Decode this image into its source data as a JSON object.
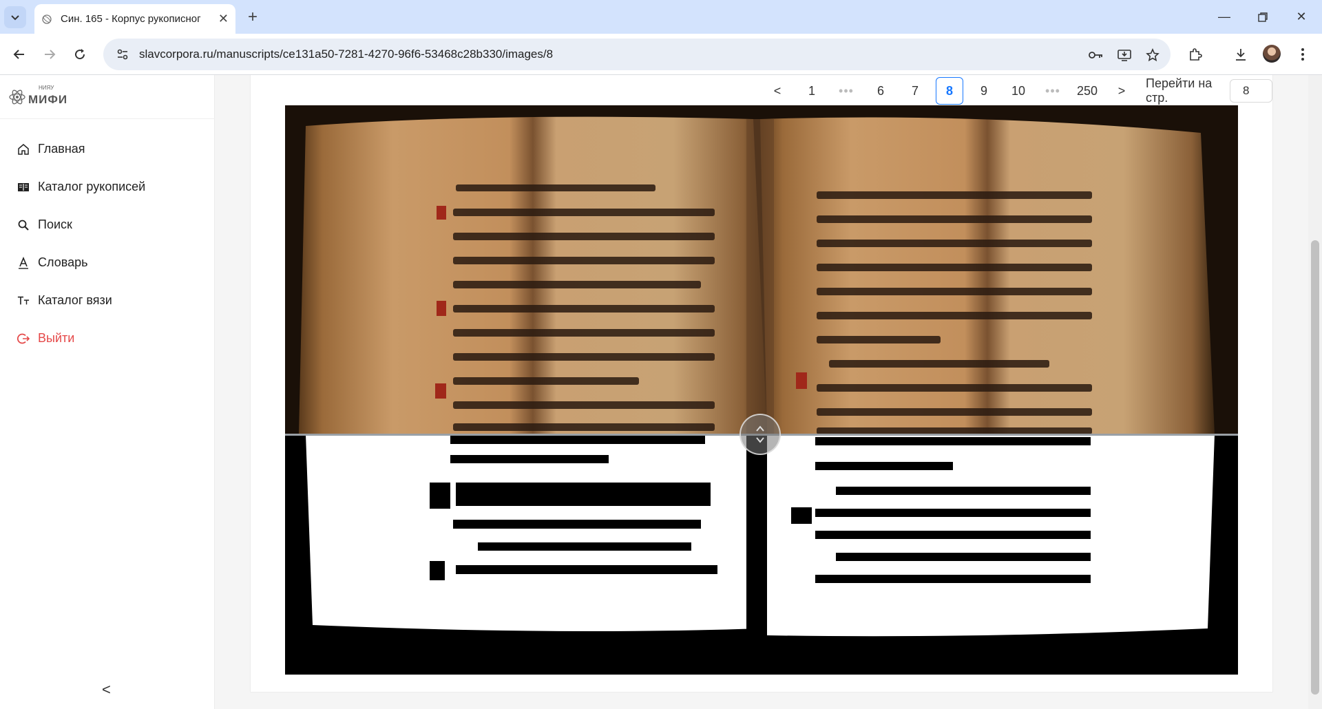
{
  "browser": {
    "tab_title": "Син. 165 - Корпус рукописног",
    "url": "slavcorpora.ru/manuscripts/ce131a50-7281-4270-96f6-53468c28b330/images/8"
  },
  "logo": {
    "small_text": "НИЯУ",
    "text": "МИФИ"
  },
  "sidebar": {
    "items": [
      {
        "label": "Главная",
        "icon": "home-icon"
      },
      {
        "label": "Каталог рукописей",
        "icon": "book-icon"
      },
      {
        "label": "Поиск",
        "icon": "search-icon"
      },
      {
        "label": "Словарь",
        "icon": "dictionary-icon"
      },
      {
        "label": "Каталог вязи",
        "icon": "text-size-icon"
      },
      {
        "label": "Выйти",
        "icon": "logout-icon"
      }
    ],
    "collapse_label": "<"
  },
  "pagination": {
    "prev": "<",
    "first": "1",
    "pages": [
      "6",
      "7",
      "8",
      "9",
      "10"
    ],
    "current": "8",
    "last": "250",
    "next": ">",
    "dots": "•••",
    "goto_label": "Перейти на стр.",
    "goto_value": "8"
  },
  "viewer": {
    "image_alt": "manuscript page comparison",
    "slider_position": 0.58
  },
  "colors": {
    "accent": "#1677ff",
    "logout": "#e54848",
    "tabbar": "#d3e3fd"
  }
}
